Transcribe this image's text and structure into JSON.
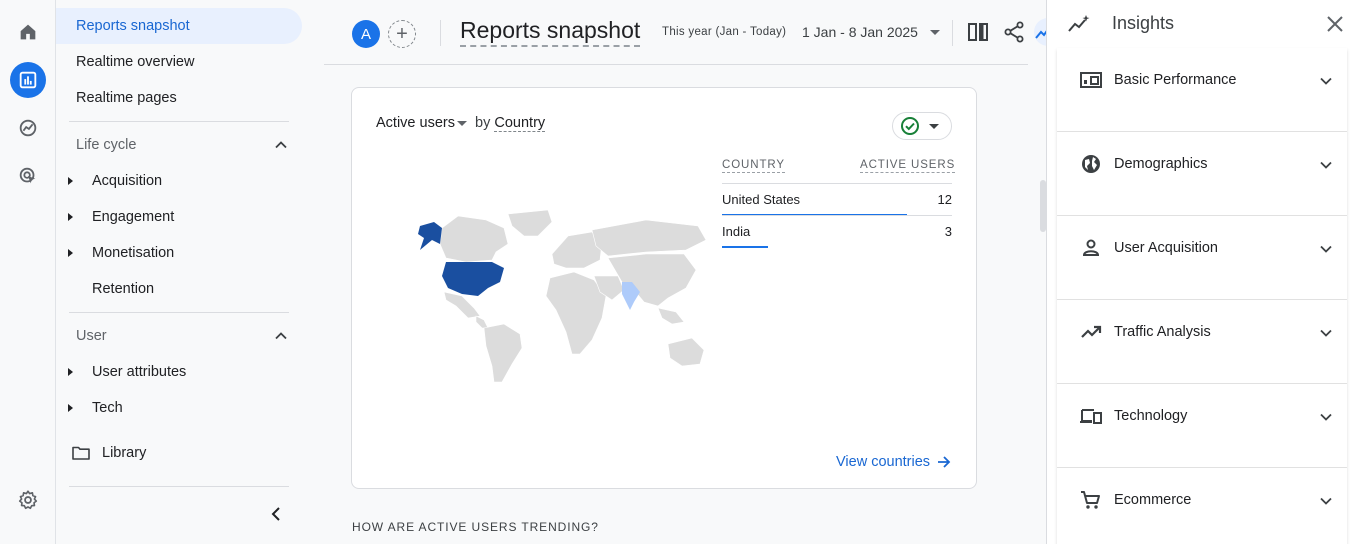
{
  "rail": {
    "items": [
      {
        "icon": "home-icon"
      },
      {
        "icon": "reports-icon",
        "active": true
      },
      {
        "icon": "explore-icon"
      },
      {
        "icon": "advertising-icon"
      },
      {
        "icon": "settings-icon"
      }
    ]
  },
  "nav": {
    "top_items": [
      "Reports snapshot",
      "Realtime overview",
      "Realtime pages"
    ],
    "lifecycle": {
      "label": "Life cycle",
      "items": [
        "Acquisition",
        "Engagement",
        "Monetisation",
        "Retention"
      ]
    },
    "user": {
      "label": "User",
      "items": [
        "User attributes",
        "Tech"
      ]
    },
    "library": "Library"
  },
  "topbar": {
    "avatar_letter": "A",
    "title": "Reports snapshot",
    "date_label": "This year (Jan - Today)",
    "date_range": "1 Jan - 8 Jan 2025"
  },
  "card": {
    "metric": "Active users",
    "by": "by",
    "dimension": "Country",
    "columns": [
      "COUNTRY",
      "ACTIVE USERS"
    ],
    "rows": [
      {
        "country": "United States",
        "users": "12",
        "share": 1.0
      },
      {
        "country": "India",
        "users": "3",
        "share": 0.25
      }
    ],
    "view_link": "View countries"
  },
  "trend_heading": "HOW ARE ACTIVE USERS TRENDING?",
  "insights": {
    "title": "Insights",
    "sections": [
      {
        "label": "Basic Performance",
        "icon": "dashboard-icon"
      },
      {
        "label": "Demographics",
        "icon": "globe-icon"
      },
      {
        "label": "User Acquisition",
        "icon": "person-icon"
      },
      {
        "label": "Traffic Analysis",
        "icon": "trending-up-icon"
      },
      {
        "label": "Technology",
        "icon": "devices-icon"
      },
      {
        "label": "Ecommerce",
        "icon": "cart-icon"
      }
    ]
  },
  "colors": {
    "accent": "#1a73e8",
    "map_high": "#1a4fa0",
    "map_low": "#aecbfa",
    "map_empty": "#dcdcdc",
    "success": "#188038"
  }
}
